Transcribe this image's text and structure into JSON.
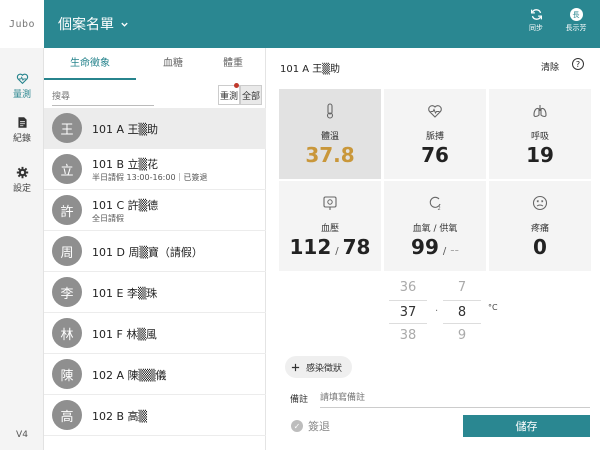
{
  "logo_text": "Jubo",
  "app_title": "個案名單",
  "rail": {
    "items": [
      {
        "label": "量測",
        "icon": "heart-pulse-icon"
      },
      {
        "label": "紀錄",
        "icon": "document-icon"
      },
      {
        "label": "設定",
        "icon": "gear-icon"
      }
    ],
    "version": "V4"
  },
  "topbar": {
    "sync_label": "同步",
    "user_initial": "長",
    "user_label": "長示芳"
  },
  "list": {
    "tabs": [
      "生命徵象",
      "血糖",
      "體重"
    ],
    "active_tab": "生命徵象",
    "search_placeholder": "搜尋",
    "filters": [
      "重測",
      "全部"
    ],
    "selected_filter": "全部",
    "rows": [
      {
        "initial": "王",
        "name": "101 A 王▒助",
        "sub": ""
      },
      {
        "initial": "立",
        "name": "101 B 立▒花",
        "sub": "半日請假 13:00-16:00｜已簽退"
      },
      {
        "initial": "許",
        "name": "101 C 許▒德",
        "sub": "全日請假"
      },
      {
        "initial": "周",
        "name": "101 D 周▒寶（請假）",
        "sub": ""
      },
      {
        "initial": "李",
        "name": "101 E 李▒珠",
        "sub": ""
      },
      {
        "initial": "林",
        "name": "101 F 林▒風",
        "sub": ""
      },
      {
        "initial": "陳",
        "name": "102 A 陳▒▒儀",
        "sub": ""
      },
      {
        "initial": "高",
        "name": "102 B 高▒",
        "sub": ""
      }
    ]
  },
  "detail": {
    "patient_title": "101 A 王▒助",
    "clear_label": "清除",
    "help_label": "?",
    "vitals": {
      "temperature": {
        "label": "體溫",
        "value": "37.8",
        "icon": "thermometer-icon"
      },
      "pulse": {
        "label": "脈搏",
        "value": "76",
        "icon": "heartbeat-icon"
      },
      "respiration": {
        "label": "呼吸",
        "value": "19",
        "icon": "lungs-icon"
      },
      "blood_pressure": {
        "label": "血壓",
        "systolic": "112",
        "separator": "/",
        "diastolic": "78",
        "icon": "blood-pressure-monitor-icon"
      },
      "oxygen": {
        "label": "血氧 / 供氧",
        "value": "99",
        "separator": "/",
        "supply": "--",
        "icon": "oxygen-icon"
      },
      "pain": {
        "label": "疼痛",
        "value": "0",
        "icon": "pain-face-icon"
      }
    },
    "picker": {
      "integer": {
        "above": "36",
        "current": "37",
        "below": "38"
      },
      "decimal": {
        "above": "7",
        "current": "8",
        "below": "9"
      },
      "separator": ".",
      "unit": "°C"
    },
    "symptom_button": "感染徵狀",
    "note_label": "備註",
    "note_placeholder": "請填寫備註",
    "leave_label": "簽退",
    "save_label": "儲存"
  },
  "colors": {
    "brand": "#2a8791",
    "temperature_alert": "#c9973a"
  }
}
